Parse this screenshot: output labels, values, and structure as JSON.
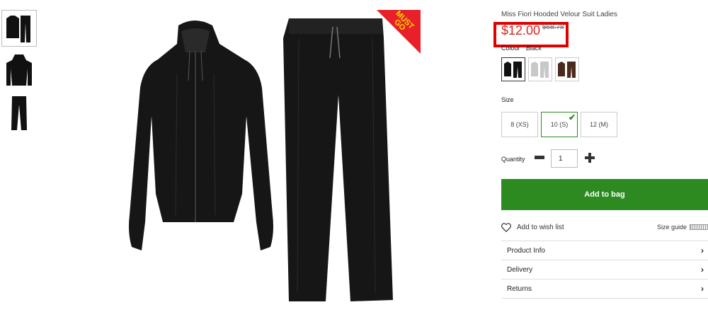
{
  "product": {
    "title": "Miss Fiori Hooded Velour Suit Ladies",
    "price": "$12.00",
    "old_price": "$68.78",
    "badge": "MUST GO"
  },
  "colour": {
    "label": "Colour",
    "selected": "Black",
    "swatches": [
      "black",
      "grey",
      "brown"
    ]
  },
  "size": {
    "label": "Size",
    "options": [
      "8 (XS)",
      "10 (S)",
      "12 (M)"
    ],
    "selected": "10 (S)"
  },
  "quantity": {
    "label": "Quantity",
    "value": "1"
  },
  "actions": {
    "add_to_bag": "Add to bag",
    "wish_list": "Add to wish list",
    "size_guide": "Size guide"
  },
  "accordion": [
    "Product Info",
    "Delivery",
    "Returns"
  ],
  "colors": {
    "price_red": "#d9261c",
    "highlight_box": "#e00000",
    "add_bag_green": "#2d8a21",
    "badge_red": "#e8202a",
    "badge_text": "#f5d800"
  }
}
